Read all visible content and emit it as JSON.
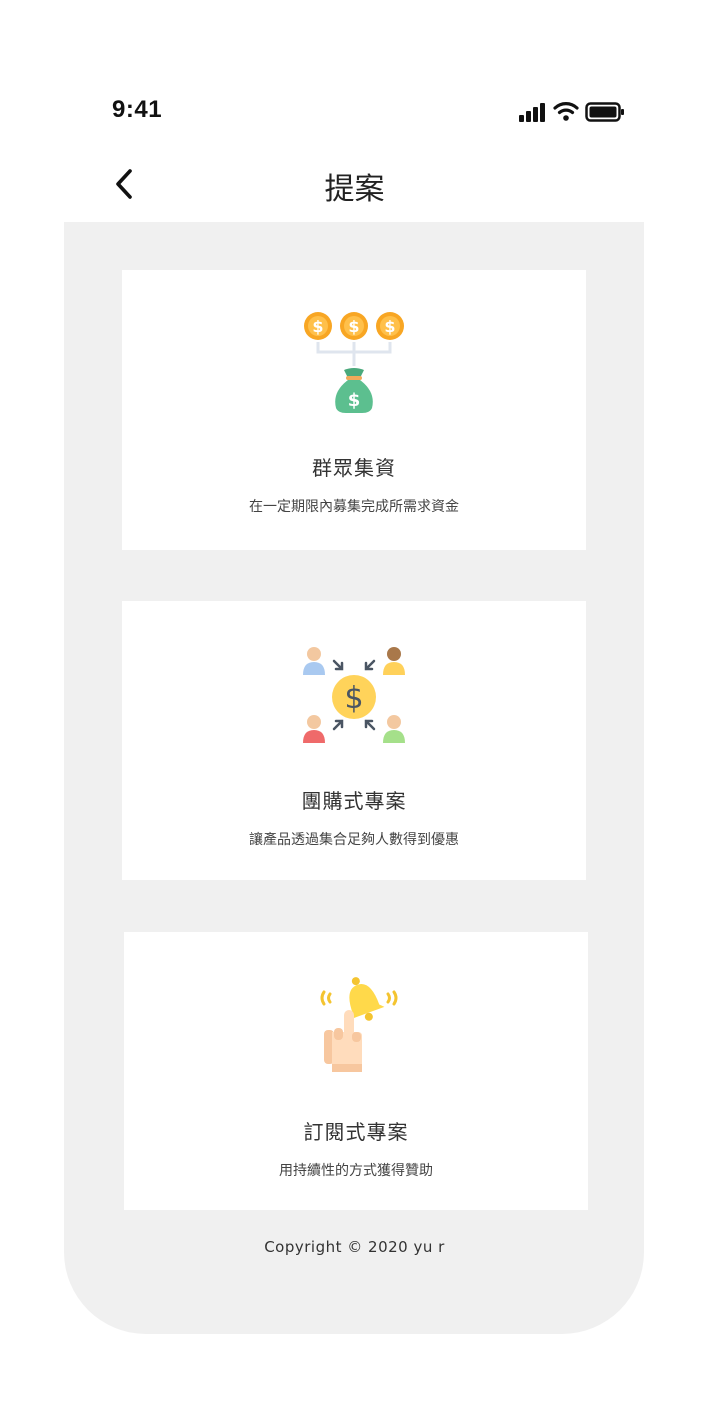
{
  "status_bar": {
    "time": "9:41",
    "icons": [
      "signal-icon",
      "wifi-icon",
      "battery-icon"
    ]
  },
  "nav": {
    "back_icon": "chevron-left-icon",
    "title": "提案"
  },
  "cards": [
    {
      "icon": "money-bag-icon",
      "title": "群眾集資",
      "description": "在一定期限內募集完成所需求資金"
    },
    {
      "icon": "group-buy-icon",
      "title": "團購式專案",
      "description": "讓產品透過集合足夠人數得到優惠"
    },
    {
      "icon": "bell-pointer-icon",
      "title": "訂閱式專案",
      "description": "用持續性的方式獲得贊助"
    }
  ],
  "footer": {
    "copyright": "Copyright © 2020 yu r"
  },
  "colors": {
    "panel_background": "#f0f0f0",
    "card_background": "#ffffff",
    "coin": "#f8a623",
    "bag": "#5cbf8f",
    "bell": "#ffd94a"
  }
}
